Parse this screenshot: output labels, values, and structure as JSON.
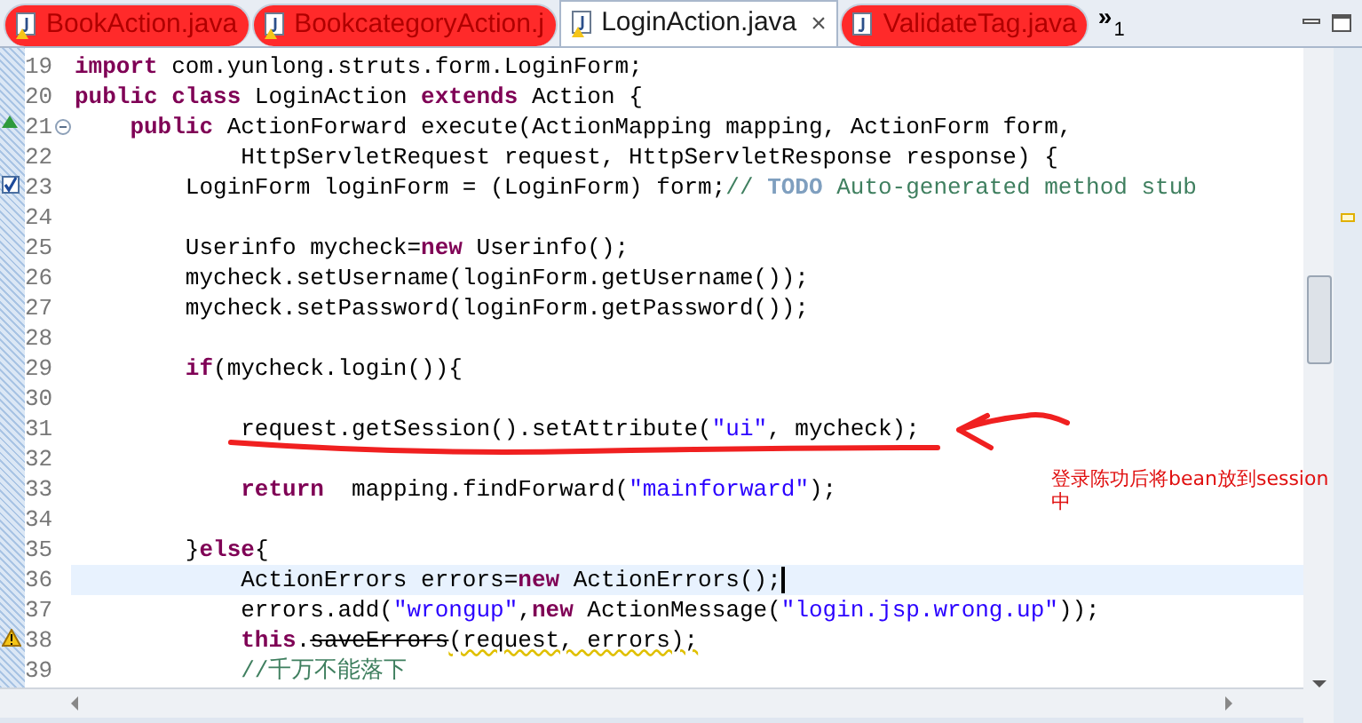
{
  "tabs": [
    {
      "label": "BookAction.java",
      "selected": false,
      "marked": true,
      "warning": true
    },
    {
      "label": "BookcategoryAction.j",
      "selected": false,
      "marked": true,
      "warning": true
    },
    {
      "label": "LoginAction.java",
      "selected": true,
      "marked": false,
      "warning": true,
      "close": "×"
    },
    {
      "label": "ValidateTag.java",
      "selected": false,
      "marked": true,
      "warning": false
    }
  ],
  "overflow": {
    "chevron": "»",
    "count": "1"
  },
  "editor": {
    "lines": [
      {
        "number": "19",
        "current": false,
        "tokens": [
          {
            "kind": "kw",
            "text": "import"
          },
          {
            "kind": "plain",
            "text": " com.yunlong.struts.form.LoginForm;"
          }
        ]
      },
      {
        "number": "20",
        "current": false,
        "tokens": [
          {
            "kind": "kw",
            "text": "public class"
          },
          {
            "kind": "plain",
            "text": " LoginAction "
          },
          {
            "kind": "kw",
            "text": "extends"
          },
          {
            "kind": "plain",
            "text": " Action {"
          }
        ]
      },
      {
        "number": "21",
        "kind": "override",
        "fold": true,
        "current": false,
        "tokens": [
          {
            "kind": "kw",
            "text": "    public"
          },
          {
            "kind": "plain",
            "text": " ActionForward execute(ActionMapping mapping, ActionForm form,"
          }
        ]
      },
      {
        "number": "22",
        "current": false,
        "tokens": [
          {
            "kind": "plain",
            "text": "            HttpServletRequest request, HttpServletResponse response) {"
          }
        ]
      },
      {
        "number": "23",
        "kind": "task",
        "current": false,
        "tokens": [
          {
            "kind": "plain",
            "text": "        LoginForm loginForm = (LoginForm) form;"
          },
          {
            "kind": "comment",
            "text": "// "
          },
          {
            "kind": "todo",
            "text": "TODO"
          },
          {
            "kind": "comment",
            "text": " Auto-generated method stub"
          }
        ]
      },
      {
        "number": "24",
        "current": false
      },
      {
        "number": "25",
        "current": false,
        "tokens": [
          {
            "kind": "plain",
            "text": "        Userinfo mycheck="
          },
          {
            "kind": "kw",
            "text": "new"
          },
          {
            "kind": "plain",
            "text": " Userinfo();"
          }
        ]
      },
      {
        "number": "26",
        "current": false,
        "tokens": [
          {
            "kind": "plain",
            "text": "        mycheck.setUsername(loginForm.getUsername());"
          }
        ]
      },
      {
        "number": "27",
        "current": false,
        "tokens": [
          {
            "kind": "plain",
            "text": "        mycheck.setPassword(loginForm.getPassword());"
          }
        ]
      },
      {
        "number": "28",
        "current": false
      },
      {
        "number": "29",
        "current": false,
        "tokens": [
          {
            "kind": "kw",
            "text": "        if"
          },
          {
            "kind": "plain",
            "text": "(mycheck.login()){"
          }
        ]
      },
      {
        "number": "30",
        "current": false
      },
      {
        "number": "31",
        "current": false,
        "tokens": [
          {
            "kind": "plain",
            "text": "            request.getSession().setAttribute("
          },
          {
            "kind": "str",
            "text": "\"ui\""
          },
          {
            "kind": "plain",
            "text": ", mycheck);"
          }
        ]
      },
      {
        "number": "32",
        "current": false
      },
      {
        "number": "33",
        "current": false,
        "tokens": [
          {
            "kind": "kw",
            "text": "            return"
          },
          {
            "kind": "plain",
            "text": "  mapping.findForward("
          },
          {
            "kind": "str",
            "text": "\"mainforward\""
          },
          {
            "kind": "plain",
            "text": ");"
          }
        ]
      },
      {
        "number": "34",
        "current": false
      },
      {
        "number": "35",
        "current": false,
        "tokens": [
          {
            "kind": "plain",
            "text": "        }"
          },
          {
            "kind": "kw",
            "text": "else"
          },
          {
            "kind": "plain",
            "text": "{"
          }
        ]
      },
      {
        "number": "36",
        "current": true,
        "tokens": [
          {
            "kind": "plain",
            "text": "            ActionErrors errors="
          },
          {
            "kind": "kw",
            "text": "new"
          },
          {
            "kind": "plain",
            "text": " ActionErrors();"
          }
        ]
      },
      {
        "number": "37",
        "current": false,
        "tokens": [
          {
            "kind": "plain",
            "text": "            errors.add("
          },
          {
            "kind": "str",
            "text": "\"wrongup\""
          },
          {
            "kind": "plain",
            "text": ","
          },
          {
            "kind": "kw",
            "text": "new"
          },
          {
            "kind": "plain",
            "text": " ActionMessage("
          },
          {
            "kind": "str",
            "text": "\"login.jsp.wrong.up\""
          },
          {
            "kind": "plain",
            "text": "));"
          }
        ]
      },
      {
        "number": "38",
        "kind": "warning",
        "current": false,
        "tokens": [
          {
            "kind": "kw",
            "text": "            this"
          },
          {
            "kind": "plain",
            "text": "."
          },
          {
            "kind": "deprecated",
            "text": "saveErrors"
          },
          {
            "kind": "warn",
            "text": "(request, errors);"
          }
        ]
      },
      {
        "number": "39",
        "current": false,
        "tokens": [
          {
            "kind": "comment",
            "text": "            //千万不能落下"
          }
        ]
      }
    ]
  },
  "note": "登录陈功后将bean放到session中"
}
